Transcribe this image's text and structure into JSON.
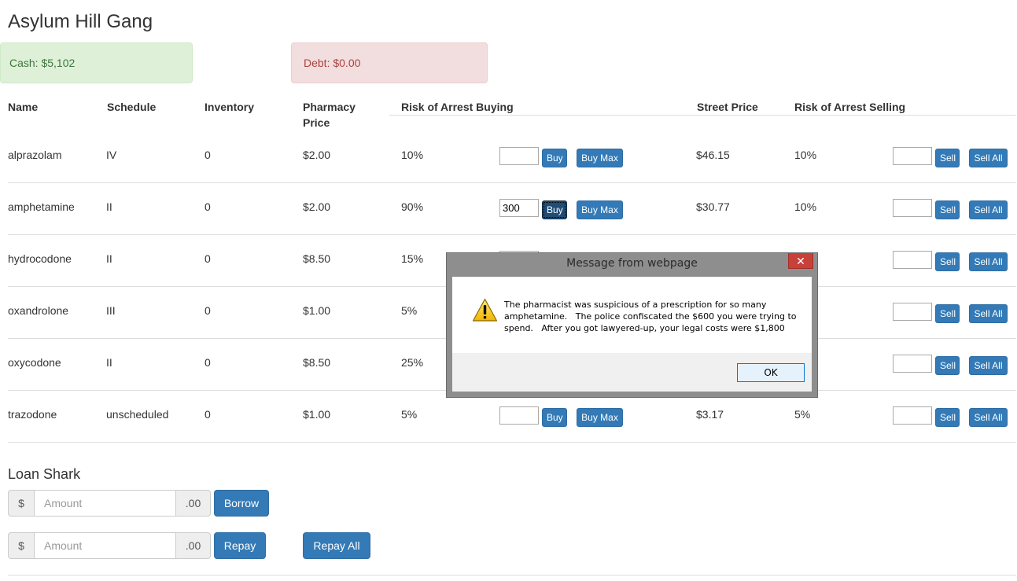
{
  "title": "Asylum Hill Gang",
  "cash": "Cash: $5,102",
  "debt": "Debt: $0.00",
  "headers": {
    "name": "Name",
    "schedule": "Schedule",
    "inventory": "Inventory",
    "pharmacy_price_1": "Pharmacy",
    "pharmacy_price_2": "Price",
    "risk_buy": "Risk of Arrest Buying",
    "street_price": "Street Price",
    "risk_sell": "Risk of Arrest Selling"
  },
  "buttons": {
    "buy": "Buy",
    "buy_max": "Buy Max",
    "sell": "Sell",
    "sell_all": "Sell All"
  },
  "rows": [
    {
      "name": "alprazolam",
      "schedule": "IV",
      "inventory": "0",
      "pharmacy_price": "$2.00",
      "risk_buy": "10%",
      "buy_qty": "",
      "street_price": "$46.15",
      "risk_sell": "10%",
      "sell_qty": ""
    },
    {
      "name": "amphetamine",
      "schedule": "II",
      "inventory": "0",
      "pharmacy_price": "$2.00",
      "risk_buy": "90%",
      "buy_qty": "300",
      "street_price": "$30.77",
      "risk_sell": "10%",
      "sell_qty": ""
    },
    {
      "name": "hydrocodone",
      "schedule": "II",
      "inventory": "0",
      "pharmacy_price": "$8.50",
      "risk_buy": "15%",
      "buy_qty": "",
      "street_price": "",
      "risk_sell": "",
      "sell_qty": ""
    },
    {
      "name": "oxandrolone",
      "schedule": "III",
      "inventory": "0",
      "pharmacy_price": "$1.00",
      "risk_buy": "5%",
      "buy_qty": "",
      "street_price": "",
      "risk_sell": "",
      "sell_qty": ""
    },
    {
      "name": "oxycodone",
      "schedule": "II",
      "inventory": "0",
      "pharmacy_price": "$8.50",
      "risk_buy": "25%",
      "buy_qty": "",
      "street_price": "",
      "risk_sell": "",
      "sell_qty": ""
    },
    {
      "name": "trazodone",
      "schedule": "unscheduled",
      "inventory": "0",
      "pharmacy_price": "$1.00",
      "risk_buy": "5%",
      "buy_qty": "",
      "street_price": "$3.17",
      "risk_sell": "5%",
      "sell_qty": ""
    }
  ],
  "loan": {
    "heading": "Loan Shark",
    "currency": "$",
    "cents": ".00",
    "placeholder": "Amount",
    "borrow": "Borrow",
    "repay": "Repay",
    "repay_all": "Repay All"
  },
  "dialog": {
    "title": "Message from webpage",
    "close": "✕",
    "message_line1": "The pharmacist was suspicious of a prescription for so many",
    "message_line2": "amphetamine.   The police confiscated the $600 you were trying to",
    "message_line3": "spend.   After you got lawyered-up, your legal costs were $1,800",
    "ok": "OK",
    "icon": "warning-icon"
  }
}
